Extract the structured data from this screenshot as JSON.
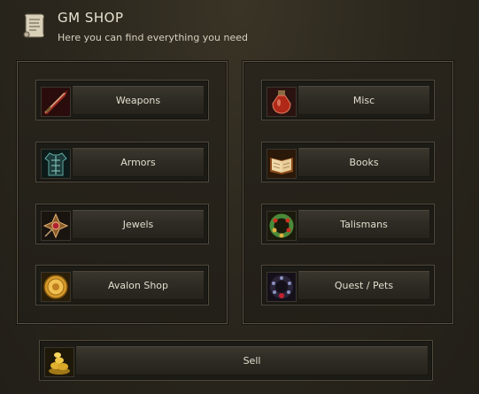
{
  "header": {
    "title": "GM SHOP",
    "subtitle": "Here you can find everything you need",
    "icon": "scroll-icon"
  },
  "left_panel": {
    "buttons": [
      {
        "label": "Weapons",
        "icon": "sword-icon"
      },
      {
        "label": "Armors",
        "icon": "armor-icon"
      },
      {
        "label": "Jewels",
        "icon": "jewel-icon"
      },
      {
        "label": "Avalon Shop",
        "icon": "coin-icon"
      }
    ]
  },
  "right_panel": {
    "buttons": [
      {
        "label": "Misc",
        "icon": "potion-icon"
      },
      {
        "label": "Books",
        "icon": "book-icon"
      },
      {
        "label": "Talismans",
        "icon": "talisman-icon"
      },
      {
        "label": "Quest / Pets",
        "icon": "pet-collar-icon"
      }
    ]
  },
  "sell": {
    "label": "Sell",
    "icon": "gold-pile-icon"
  }
}
